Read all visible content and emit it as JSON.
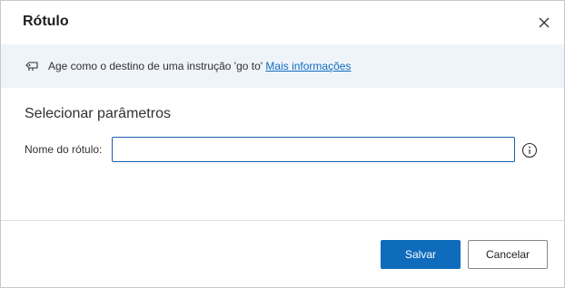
{
  "dialog": {
    "title": "Rótulo",
    "close_icon": "close-icon"
  },
  "infobar": {
    "icon": "label-pin-icon",
    "text": "Age como o destino de uma instrução 'go to'",
    "link": "Mais informações"
  },
  "section": {
    "title": "Selecionar parâmetros"
  },
  "fields": {
    "label_name": {
      "label": "Nome do rótulo:",
      "value": "",
      "help_icon": "info-icon"
    }
  },
  "footer": {
    "save_label": "Salvar",
    "cancel_label": "Cancelar"
  },
  "colors": {
    "accent": "#0f6cbd",
    "infobar_bg": "#eff4fb",
    "input_border": "#1a5fa8"
  }
}
